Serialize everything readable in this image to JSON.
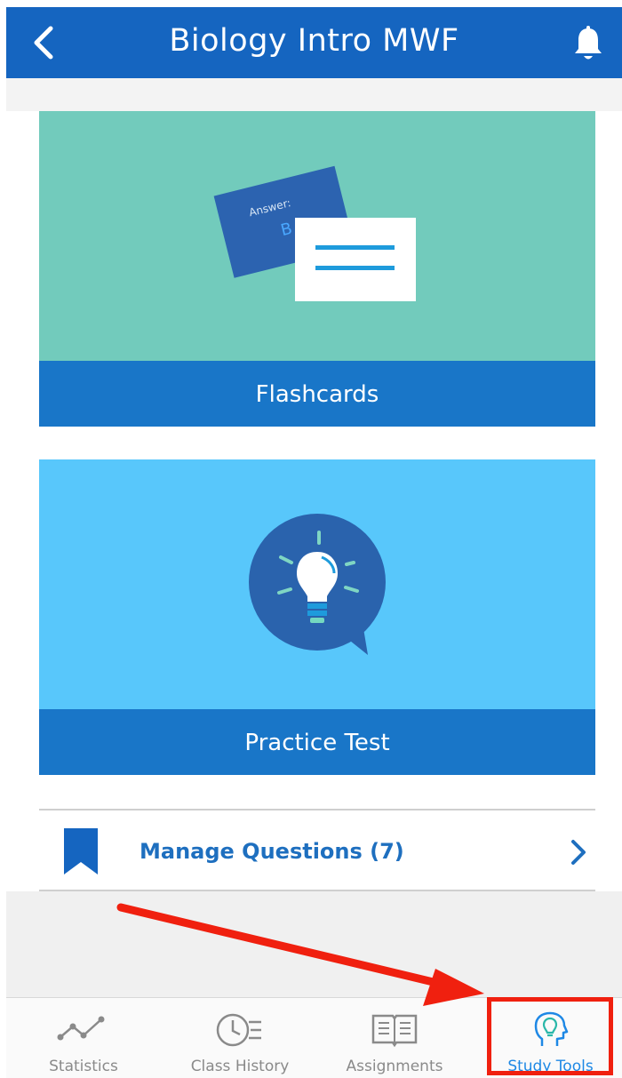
{
  "header": {
    "title": "Biology Intro MWF",
    "back_icon": "chevron-left-icon",
    "bell_icon": "bell-icon"
  },
  "cards": [
    {
      "label": "Flashcards",
      "art_text": "Answer:",
      "art_letter": "B",
      "bg": "#72cbbc"
    },
    {
      "label": "Practice Test",
      "bg": "#58c7fb"
    }
  ],
  "manage": {
    "label": "Manage Questions (7)"
  },
  "tabs": [
    {
      "label": "Statistics",
      "icon": "line-chart-icon",
      "active": false
    },
    {
      "label": "Class History",
      "icon": "clock-history-icon",
      "active": false
    },
    {
      "label": "Assignments",
      "icon": "book-icon",
      "active": false
    },
    {
      "label": "Study Tools",
      "icon": "lightbulb-head-icon",
      "active": true
    }
  ],
  "colors": {
    "header": "#1565c0",
    "caption": "#1976c8",
    "active_tab": "#1e88e5",
    "annotation": "#f0200f"
  }
}
